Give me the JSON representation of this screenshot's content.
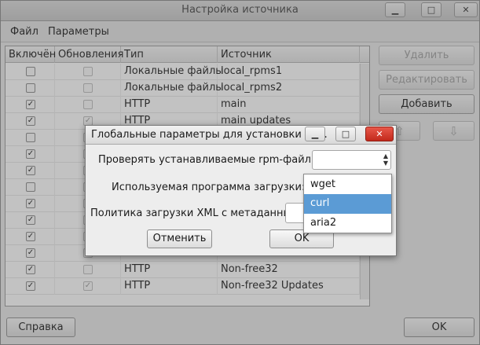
{
  "window": {
    "title": "Настройка источника",
    "minimize_icon": "minimize-icon",
    "maximize_icon": "maximize-icon",
    "close_icon": "close-icon"
  },
  "menu": [
    "Файл",
    "Параметры"
  ],
  "table": {
    "headers": [
      "Включён",
      "Обновления",
      "Тип",
      "Источник"
    ],
    "rows": [
      {
        "enabled": false,
        "updates": false,
        "type": "Локальные файлы",
        "source": "local_rpms1"
      },
      {
        "enabled": false,
        "updates": false,
        "type": "Локальные файлы",
        "source": "local_rpms2"
      },
      {
        "enabled": true,
        "updates": false,
        "type": "HTTP",
        "source": "main"
      },
      {
        "enabled": true,
        "updates": true,
        "type": "HTTP",
        "source": "main updates"
      },
      {
        "enabled": false,
        "updates": false,
        "type": "",
        "source": ""
      },
      {
        "enabled": true,
        "updates": false,
        "type": "",
        "source": ""
      },
      {
        "enabled": true,
        "updates": false,
        "type": "",
        "source": ""
      },
      {
        "enabled": false,
        "updates": false,
        "type": "",
        "source": ""
      },
      {
        "enabled": true,
        "updates": false,
        "type": "",
        "source": ""
      },
      {
        "enabled": true,
        "updates": false,
        "type": "",
        "source": ""
      },
      {
        "enabled": true,
        "updates": false,
        "type": "",
        "source": ""
      },
      {
        "enabled": true,
        "updates": false,
        "type": "",
        "source": ""
      },
      {
        "enabled": true,
        "updates": false,
        "type": "HTTP",
        "source": "Non-free32"
      },
      {
        "enabled": true,
        "updates": true,
        "type": "HTTP",
        "source": "Non-free32 Updates"
      }
    ]
  },
  "side_buttons": {
    "remove": "Удалить",
    "edit": "Редактировать",
    "add": "Добавить",
    "up_icon": "arrow-up-icon",
    "down_icon": "arrow-down-icon"
  },
  "bottom_buttons": {
    "help": "Справка",
    "ok": "OK"
  },
  "dialog": {
    "title": "Глобальные параметры для установки па...",
    "verify_label": "Проверять устанавливаемые rpm-файлы:",
    "downloader_label": "Используемая программа загрузки:",
    "xml_policy_label": "Политика загрузки XML с метаданными:",
    "cancel": "Отменить",
    "ok": "OK"
  },
  "dropdown": {
    "options": [
      "wget",
      "curl",
      "aria2"
    ],
    "selected": "curl"
  },
  "colors": {
    "selection": "#5b9bd5",
    "close_button": "#d63a2b"
  }
}
